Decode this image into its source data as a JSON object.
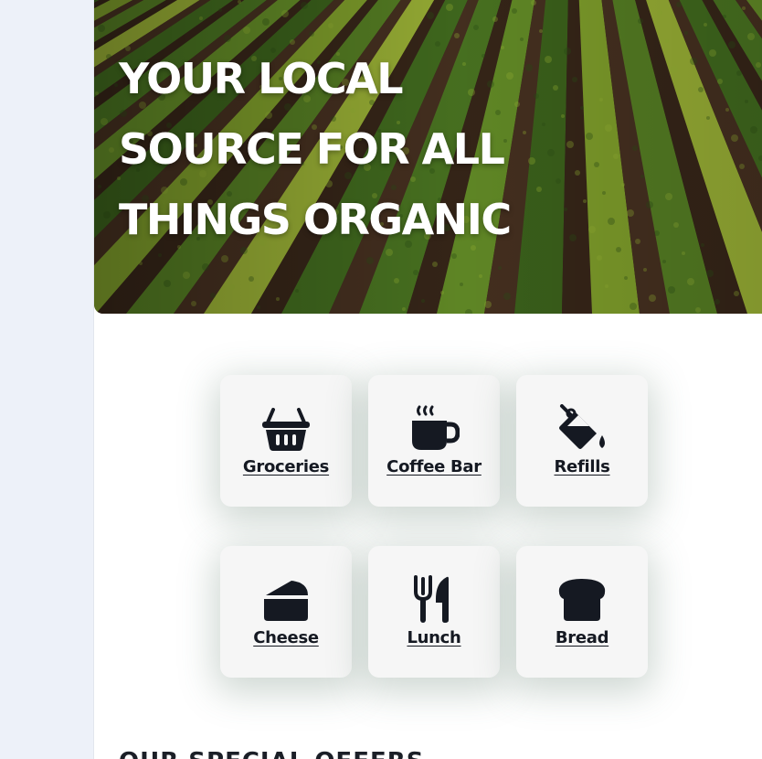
{
  "hero": {
    "title_lines": [
      "YOUR LOCAL",
      "SOURCE FOR ALL",
      "THINGS ORGANIC"
    ],
    "image": "aerial-crop-field-rows"
  },
  "categories": [
    {
      "label": "Groceries",
      "icon": "basket-icon"
    },
    {
      "label": "Coffee Bar",
      "icon": "coffee-mug-icon"
    },
    {
      "label": "Refills",
      "icon": "fill-drip-icon"
    },
    {
      "label": "Cheese",
      "icon": "cheese-icon"
    },
    {
      "label": "Lunch",
      "icon": "utensils-icon"
    },
    {
      "label": "Bread",
      "icon": "bread-icon"
    }
  ],
  "next_section": {
    "heading": "OUR SPECIAL OFFERS"
  },
  "colors": {
    "page_bg": "#edf1f9",
    "tile_bg": "#f6f6f6",
    "icon_color": "#151922",
    "hero_text": "#ffffff"
  }
}
